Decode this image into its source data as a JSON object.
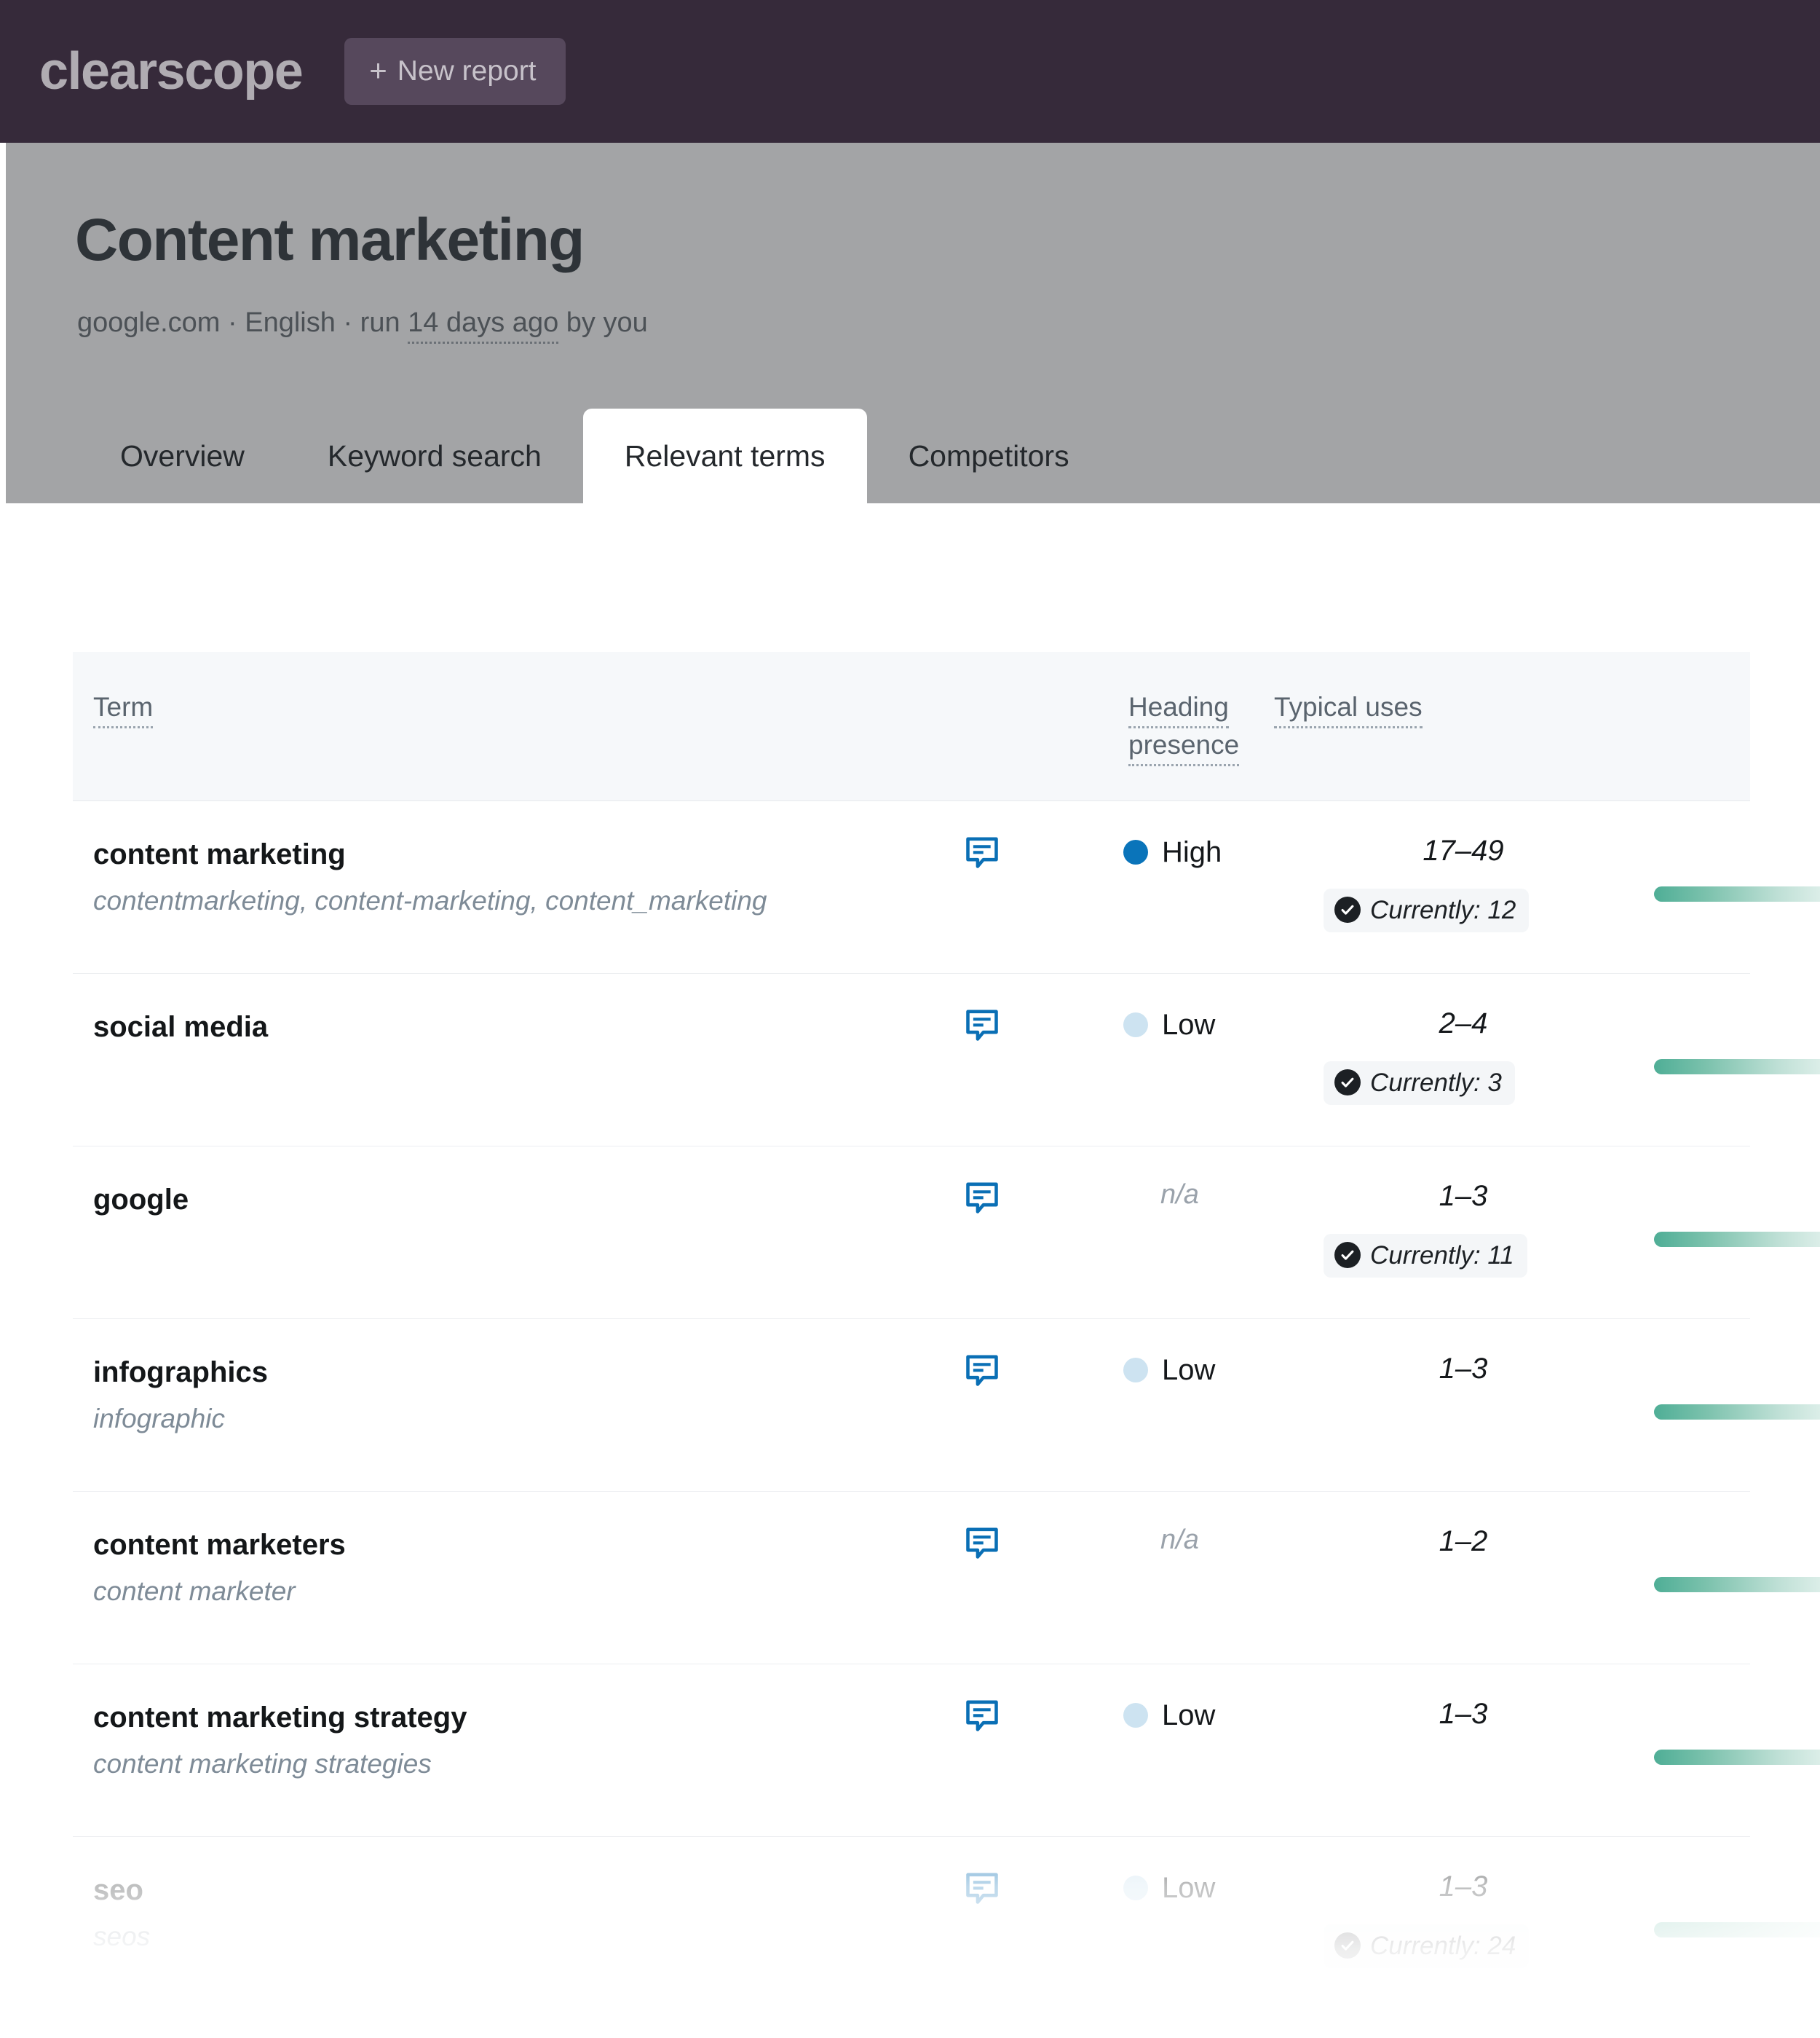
{
  "topbar": {
    "brand": "clearscope",
    "new_report_label": "New report",
    "plus_glyph": "+",
    "bg_color": "#362a3a"
  },
  "report": {
    "title": "Content marketing",
    "meta_domain": "google.com",
    "meta_sep1": " · ",
    "meta_language": "English",
    "meta_sep2": " · ",
    "meta_run_prefix": "run ",
    "meta_run_age": "14 days ago",
    "meta_run_suffix": " by you",
    "header_bg": "#a3a4a6"
  },
  "tabs": [
    {
      "label": "Overview",
      "active": false
    },
    {
      "label": "Keyword search",
      "active": false
    },
    {
      "label": "Relevant terms",
      "active": true
    },
    {
      "label": "Competitors",
      "active": false
    }
  ],
  "table": {
    "columns": {
      "term": "Term",
      "heading_presence_line1": "Heading",
      "heading_presence_line2": "presence",
      "typical_uses": "Typical uses"
    },
    "accent_high": "#0a74ba",
    "accent_low": "#cde3f1",
    "bar_color": "#4fae96",
    "rows": [
      {
        "term": "content marketing",
        "synonyms": "contentmarketing, content-marketing, content_marketing",
        "heading_presence": "High",
        "heading_presence_type": "high",
        "typical_uses": "17–49",
        "currently_label": "Currently: 12",
        "has_currently": true,
        "faded": false
      },
      {
        "term": "social media",
        "synonyms": "",
        "heading_presence": "Low",
        "heading_presence_type": "low",
        "typical_uses": "2–4",
        "currently_label": "Currently: 3",
        "has_currently": true,
        "faded": false
      },
      {
        "term": "google",
        "synonyms": "",
        "heading_presence": "n/a",
        "heading_presence_type": "na",
        "typical_uses": "1–3",
        "currently_label": "Currently: 11",
        "has_currently": true,
        "faded": false
      },
      {
        "term": "infographics",
        "synonyms": "infographic",
        "heading_presence": "Low",
        "heading_presence_type": "low",
        "typical_uses": "1–3",
        "currently_label": "",
        "has_currently": false,
        "faded": false
      },
      {
        "term": "content marketers",
        "synonyms": "content marketer",
        "heading_presence": "n/a",
        "heading_presence_type": "na",
        "typical_uses": "1–2",
        "currently_label": "",
        "has_currently": false,
        "faded": false
      },
      {
        "term": "content marketing strategy",
        "synonyms": "content marketing strategies",
        "heading_presence": "Low",
        "heading_presence_type": "low",
        "typical_uses": "1–3",
        "currently_label": "",
        "has_currently": false,
        "faded": false
      },
      {
        "term": "seo",
        "synonyms": "seos",
        "heading_presence": "Low",
        "heading_presence_type": "low",
        "typical_uses": "1–3",
        "currently_label": "Currently: 24",
        "has_currently": true,
        "faded": true
      }
    ]
  },
  "icons": {
    "chat": "comment-icon",
    "check": "check-circle-icon"
  }
}
